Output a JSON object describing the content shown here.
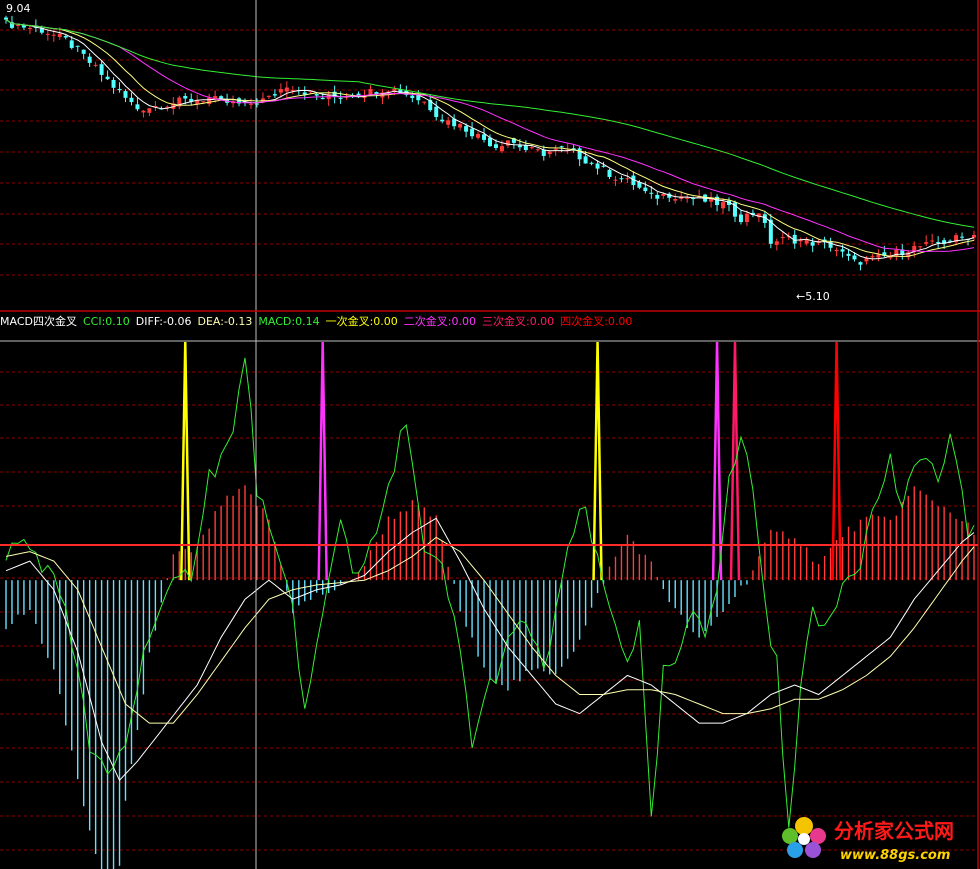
{
  "colors": {
    "background": "#000000",
    "up": "#ff3b3b",
    "down": "#54ffff",
    "grid": "#8b0000",
    "axis": "#c00000",
    "crosshair": "#bfbfbf",
    "ma_short": "#ffffff",
    "ma_mid": "#ffff80",
    "ma_20": "#ff33ff",
    "ma_60": "#33ee33",
    "cci": "#33ee33",
    "diff": "#ffffff",
    "dea": "#ffffb0",
    "macd_pos": "#ff3b3b",
    "macd_neg": "#66e0ff",
    "cross1": "#ffff00",
    "cross2": "#ff33ff",
    "cross3": "#ff1a66",
    "cross4": "#ff0000"
  },
  "price_panel": {
    "high_label": "9.04",
    "low_label": "←5.10"
  },
  "indicator_legend": [
    {
      "text": "MACD四次金叉",
      "color": "#ffffff"
    },
    {
      "text": "CCI:0.10",
      "color": "#33ee33"
    },
    {
      "text": "DIFF:-0.06",
      "color": "#ffffff"
    },
    {
      "text": "DEA:-0.13",
      "color": "#ffffb0"
    },
    {
      "text": "MACD:0.14",
      "color": "#33ee33"
    },
    {
      "text": "一次金叉:0.00",
      "color": "#ffff00"
    },
    {
      "text": "二次金叉:0.00",
      "color": "#ff33ff"
    },
    {
      "text": "三次金叉:0.00",
      "color": "#ff1a66"
    },
    {
      "text": "四次金叉:0.00",
      "color": "#ff0000"
    }
  ],
  "watermark": {
    "title": "分析家公式网",
    "url": "www.88gs.com"
  },
  "chart_data": [
    {
      "type": "candlestick",
      "title": "",
      "ylim": [
        4.9,
        9.2
      ],
      "series": [
        "candles",
        "MA",
        "MA",
        "MA20",
        "MA60"
      ],
      "max_label": 9.04,
      "min_label": 5.1,
      "close_path": [
        [
          0,
          8.95
        ],
        [
          3,
          8.9
        ],
        [
          6,
          8.85
        ],
        [
          10,
          8.7
        ],
        [
          12,
          8.55
        ],
        [
          16,
          8.2
        ],
        [
          20,
          7.85
        ],
        [
          22,
          7.7
        ],
        [
          26,
          7.75
        ],
        [
          30,
          7.82
        ],
        [
          34,
          7.85
        ],
        [
          36,
          7.8
        ],
        [
          40,
          7.75
        ],
        [
          44,
          7.85
        ],
        [
          47,
          8.05
        ],
        [
          50,
          7.95
        ],
        [
          53,
          7.85
        ],
        [
          57,
          7.9
        ],
        [
          61,
          7.95
        ],
        [
          64,
          8.0
        ],
        [
          66,
          7.95
        ],
        [
          70,
          7.8
        ],
        [
          73,
          7.55
        ],
        [
          76,
          7.45
        ],
        [
          79,
          7.3
        ],
        [
          82,
          7.15
        ],
        [
          84,
          7.25
        ],
        [
          87,
          7.1
        ],
        [
          90,
          7.05
        ],
        [
          93,
          7.1
        ],
        [
          96,
          7.0
        ],
        [
          99,
          6.85
        ],
        [
          102,
          6.7
        ],
        [
          105,
          6.6
        ],
        [
          108,
          6.4
        ],
        [
          111,
          6.45
        ],
        [
          114,
          6.4
        ],
        [
          117,
          6.35
        ],
        [
          120,
          6.3
        ],
        [
          123,
          6.1
        ],
        [
          126,
          6.2
        ],
        [
          128,
          5.75
        ],
        [
          131,
          5.8
        ],
        [
          134,
          5.75
        ],
        [
          138,
          5.7
        ],
        [
          142,
          5.45
        ],
        [
          145,
          5.5
        ],
        [
          148,
          5.55
        ],
        [
          151,
          5.65
        ],
        [
          154,
          5.7
        ],
        [
          157,
          5.75
        ],
        [
          159,
          5.8
        ],
        [
          162,
          5.85
        ]
      ]
    },
    {
      "type": "line",
      "title": "MACD四次金叉",
      "ylim": [
        -0.6,
        0.5
      ],
      "series": [
        {
          "name": "CCI"
        },
        {
          "name": "DIFF"
        },
        {
          "name": "DEA"
        },
        {
          "name": "MACD"
        },
        {
          "name": "一次金叉"
        },
        {
          "name": "二次金叉"
        },
        {
          "name": "三次金叉"
        },
        {
          "name": "四次金叉"
        }
      ],
      "cci_path": [
        [
          0,
          0.06
        ],
        [
          3,
          0.08
        ],
        [
          6,
          0.04
        ],
        [
          10,
          -0.05
        ],
        [
          14,
          -0.35
        ],
        [
          17,
          -0.42
        ],
        [
          20,
          -0.34
        ],
        [
          24,
          -0.1
        ],
        [
          28,
          -0.02
        ],
        [
          31,
          0.02
        ],
        [
          34,
          0.22
        ],
        [
          38,
          0.3
        ],
        [
          40,
          0.48
        ],
        [
          42,
          0.2
        ],
        [
          45,
          0.05
        ],
        [
          48,
          -0.05
        ],
        [
          50,
          -0.28
        ],
        [
          53,
          -0.08
        ],
        [
          56,
          0.14
        ],
        [
          58,
          0.02
        ],
        [
          61,
          0.06
        ],
        [
          64,
          0.18
        ],
        [
          67,
          0.35
        ],
        [
          70,
          0.05
        ],
        [
          73,
          0.02
        ],
        [
          76,
          -0.15
        ],
        [
          78,
          -0.34
        ],
        [
          81,
          -0.22
        ],
        [
          84,
          -0.14
        ],
        [
          87,
          -0.08
        ],
        [
          90,
          -0.2
        ],
        [
          92,
          -0.06
        ],
        [
          95,
          0.1
        ],
        [
          97,
          0.15
        ],
        [
          99,
          0.03
        ],
        [
          101,
          -0.06
        ],
        [
          104,
          -0.16
        ],
        [
          106,
          -0.1
        ],
        [
          108,
          -0.52
        ],
        [
          110,
          -0.2
        ],
        [
          113,
          -0.16
        ],
        [
          115,
          -0.06
        ],
        [
          117,
          -0.1
        ],
        [
          119,
          0.0
        ],
        [
          121,
          0.2
        ],
        [
          123,
          0.3
        ],
        [
          125,
          0.2
        ],
        [
          127,
          -0.05
        ],
        [
          129,
          -0.18
        ],
        [
          131,
          -0.54
        ],
        [
          133,
          -0.2
        ],
        [
          135,
          -0.08
        ],
        [
          137,
          -0.1
        ],
        [
          140,
          0.0
        ],
        [
          143,
          0.05
        ],
        [
          146,
          0.18
        ],
        [
          148,
          0.25
        ],
        [
          150,
          0.15
        ],
        [
          152,
          0.22
        ],
        [
          154,
          0.28
        ],
        [
          156,
          0.2
        ],
        [
          158,
          0.3
        ],
        [
          161,
          0.1
        ],
        [
          162,
          0.12
        ]
      ],
      "diff_path": [
        [
          0,
          0.02
        ],
        [
          4,
          0.04
        ],
        [
          8,
          -0.02
        ],
        [
          12,
          -0.15
        ],
        [
          16,
          -0.34
        ],
        [
          19,
          -0.42
        ],
        [
          22,
          -0.38
        ],
        [
          27,
          -0.3
        ],
        [
          32,
          -0.22
        ],
        [
          36,
          -0.12
        ],
        [
          40,
          -0.04
        ],
        [
          44,
          0.0
        ],
        [
          48,
          -0.04
        ],
        [
          52,
          -0.02
        ],
        [
          56,
          -0.01
        ],
        [
          60,
          0.01
        ],
        [
          64,
          0.06
        ],
        [
          68,
          0.1
        ],
        [
          72,
          0.13
        ],
        [
          76,
          0.04
        ],
        [
          80,
          -0.06
        ],
        [
          84,
          -0.14
        ],
        [
          88,
          -0.2
        ],
        [
          92,
          -0.26
        ],
        [
          96,
          -0.28
        ],
        [
          100,
          -0.24
        ],
        [
          104,
          -0.2
        ],
        [
          108,
          -0.22
        ],
        [
          112,
          -0.26
        ],
        [
          116,
          -0.3
        ],
        [
          120,
          -0.3
        ],
        [
          124,
          -0.28
        ],
        [
          128,
          -0.24
        ],
        [
          132,
          -0.22
        ],
        [
          136,
          -0.24
        ],
        [
          140,
          -0.2
        ],
        [
          144,
          -0.16
        ],
        [
          148,
          -0.12
        ],
        [
          152,
          -0.04
        ],
        [
          156,
          0.02
        ],
        [
          160,
          0.08
        ],
        [
          162,
          0.1
        ]
      ],
      "dea_path": [
        [
          0,
          0.05
        ],
        [
          4,
          0.06
        ],
        [
          8,
          0.04
        ],
        [
          12,
          -0.02
        ],
        [
          16,
          -0.14
        ],
        [
          20,
          -0.26
        ],
        [
          24,
          -0.3
        ],
        [
          28,
          -0.3
        ],
        [
          32,
          -0.24
        ],
        [
          36,
          -0.17
        ],
        [
          40,
          -0.1
        ],
        [
          44,
          -0.04
        ],
        [
          48,
          -0.02
        ],
        [
          52,
          -0.01
        ],
        [
          56,
          -0.005
        ],
        [
          60,
          0.0
        ],
        [
          64,
          0.02
        ],
        [
          68,
          0.05
        ],
        [
          72,
          0.09
        ],
        [
          76,
          0.06
        ],
        [
          80,
          0.0
        ],
        [
          84,
          -0.07
        ],
        [
          88,
          -0.14
        ],
        [
          92,
          -0.2
        ],
        [
          96,
          -0.24
        ],
        [
          100,
          -0.24
        ],
        [
          104,
          -0.23
        ],
        [
          108,
          -0.23
        ],
        [
          112,
          -0.24
        ],
        [
          116,
          -0.26
        ],
        [
          120,
          -0.28
        ],
        [
          124,
          -0.28
        ],
        [
          128,
          -0.27
        ],
        [
          132,
          -0.25
        ],
        [
          136,
          -0.25
        ],
        [
          140,
          -0.23
        ],
        [
          144,
          -0.2
        ],
        [
          148,
          -0.16
        ],
        [
          152,
          -0.1
        ],
        [
          156,
          -0.03
        ],
        [
          160,
          0.04
        ],
        [
          162,
          0.07
        ]
      ],
      "golden_crosses": [
        {
          "kind": 1,
          "x": 30
        },
        {
          "kind": 2,
          "x": 53
        },
        {
          "kind": 1,
          "x": 99
        },
        {
          "kind": 2,
          "x": 119
        },
        {
          "kind": 3,
          "x": 122
        },
        {
          "kind": 4,
          "x": 139
        }
      ]
    }
  ]
}
